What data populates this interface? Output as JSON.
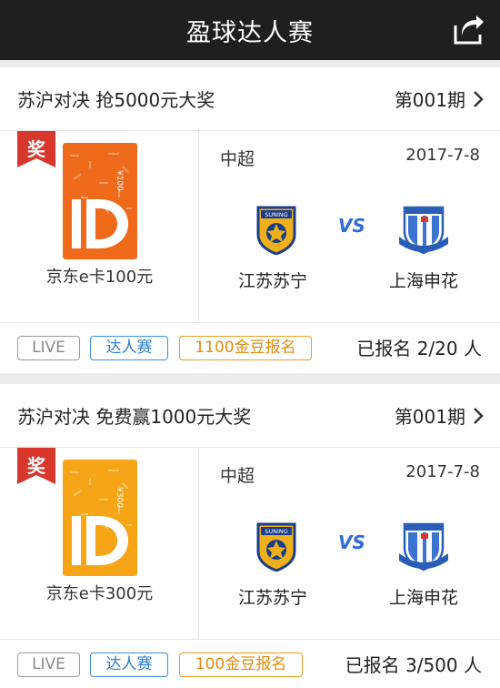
{
  "topbar": {
    "title": "盈球达人赛",
    "share_icon": "share-icon"
  },
  "colors": {
    "topbar_bg": "#1f1f1f",
    "badge_red": "#d8372e",
    "vs_blue": "#2f6cd8",
    "tag_blue": "#2a7ed2",
    "tag_gold": "#e28c0a",
    "card1_orange": "#f06a1c",
    "card2_orange": "#f5a515"
  },
  "matches": [
    {
      "title": "苏沪对决 抢5000元大奖",
      "period": "第001期",
      "badge": "奖",
      "card_value": "¥100",
      "prize": "京东e卡100元",
      "league": "中超",
      "date": "2017-7-8",
      "home_team": "江苏苏宁",
      "away_team": "上海申花",
      "vs": "VS",
      "tags": {
        "live": "LIVE",
        "expert": "达人赛",
        "join": "1100金豆报名"
      },
      "signup": "已报名 2/20 人"
    },
    {
      "title": "苏沪对决 免费赢1000元大奖",
      "period": "第001期",
      "badge": "奖",
      "card_value": "¥300",
      "prize": "京东e卡300元",
      "league": "中超",
      "date": "2017-7-8",
      "home_team": "江苏苏宁",
      "away_team": "上海申花",
      "vs": "VS",
      "tags": {
        "live": "LIVE",
        "expert": "达人赛",
        "join": "100金豆报名"
      },
      "signup": "已报名 3/500 人"
    }
  ]
}
